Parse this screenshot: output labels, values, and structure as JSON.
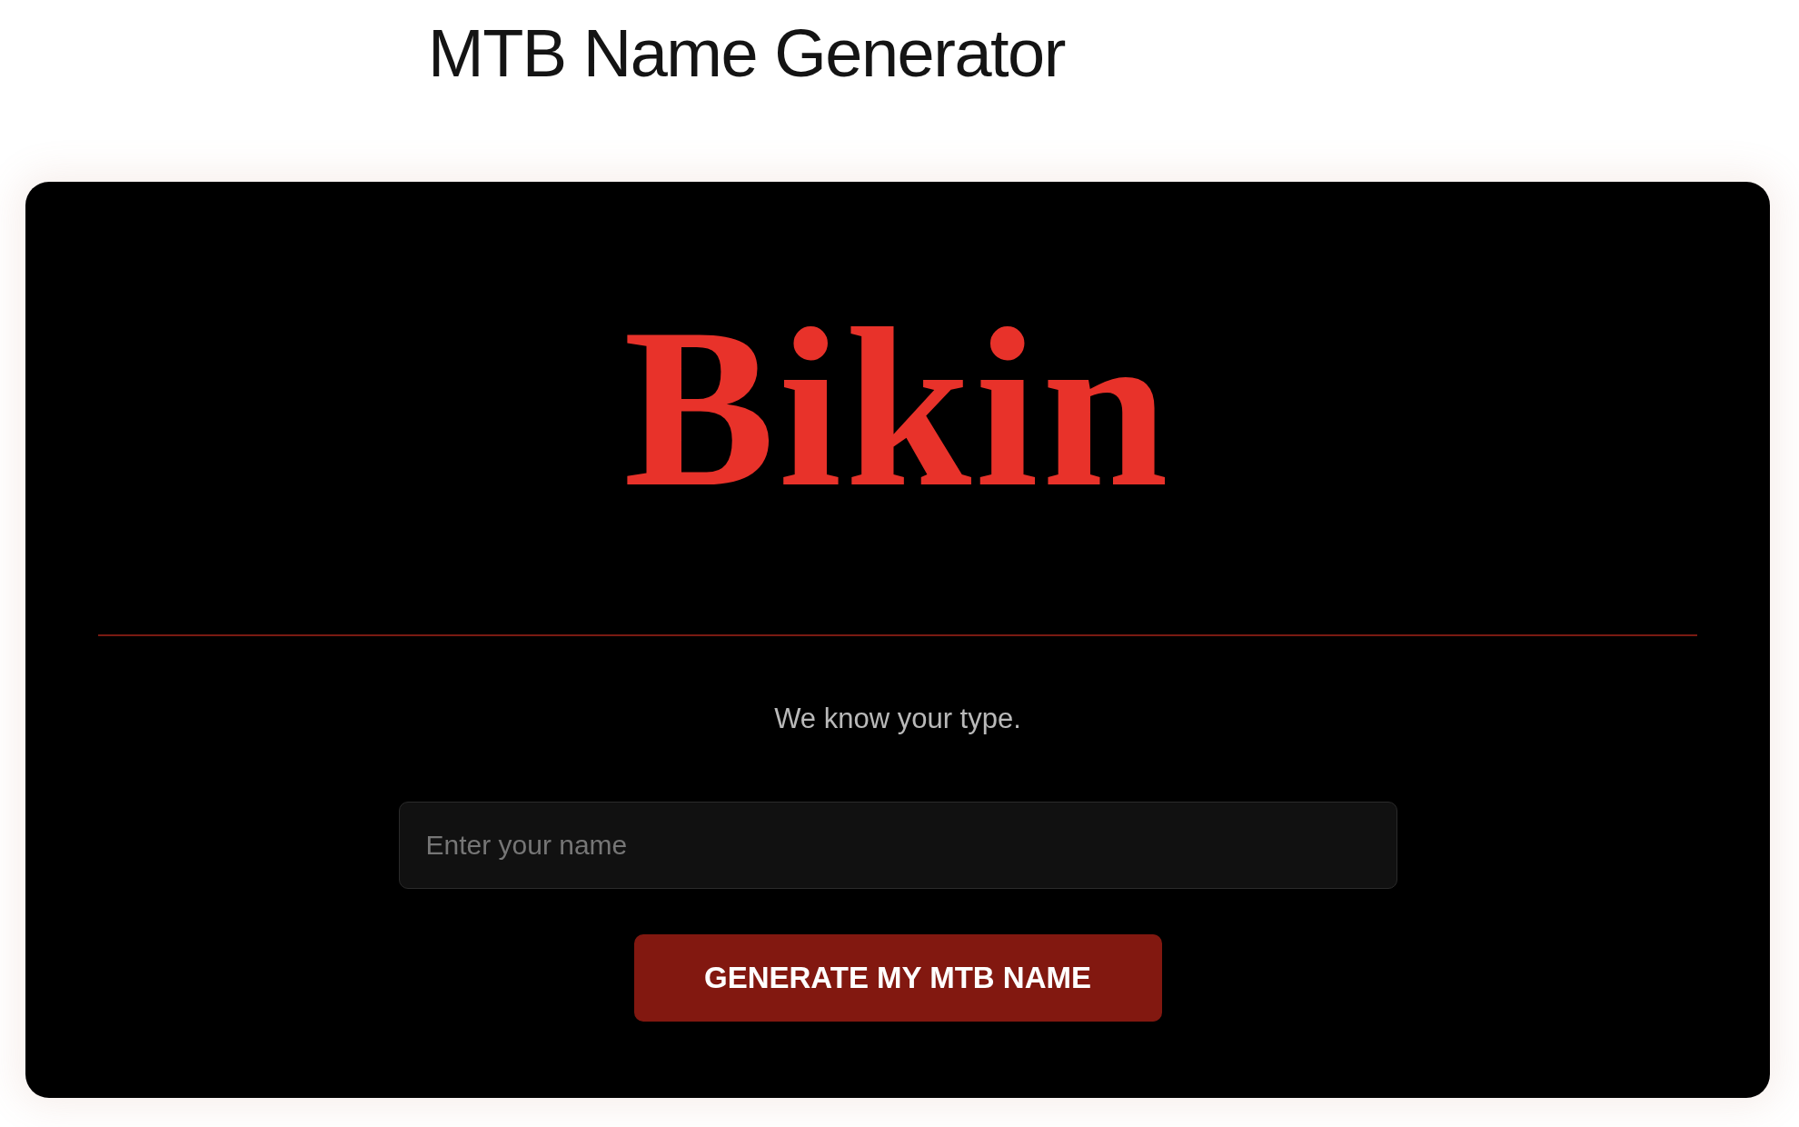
{
  "title": "MTB Name Generator",
  "card": {
    "logo": "Bikin",
    "tagline": "We know your type.",
    "name_field": {
      "placeholder": "Enter your name"
    },
    "button": {
      "label": "GENERATE MY MTB NAME"
    }
  }
}
